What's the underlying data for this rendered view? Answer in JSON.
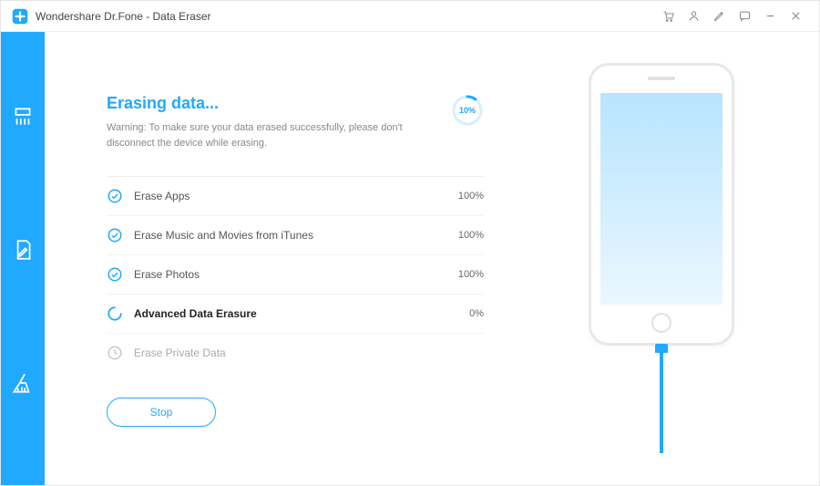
{
  "window": {
    "title": "Wondershare Dr.Fone - Data Eraser"
  },
  "header": {
    "heading": "Erasing data...",
    "warning": "Warning: To make sure your data erased successfully, please don't disconnect the device while erasing.",
    "progress_percent_label": "10%",
    "progress_percent": 10
  },
  "tasks": [
    {
      "status": "done",
      "label": "Erase Apps",
      "value": "100%"
    },
    {
      "status": "done",
      "label": "Erase Music and Movies from iTunes",
      "value": "100%"
    },
    {
      "status": "done",
      "label": "Erase Photos",
      "value": "100%"
    },
    {
      "status": "active",
      "label": "Advanced Data Erasure",
      "value": "0%"
    },
    {
      "status": "pending",
      "label": "Erase Private Data",
      "value": ""
    }
  ],
  "actions": {
    "stop_label": "Stop"
  },
  "colors": {
    "accent": "#20a9ff"
  }
}
